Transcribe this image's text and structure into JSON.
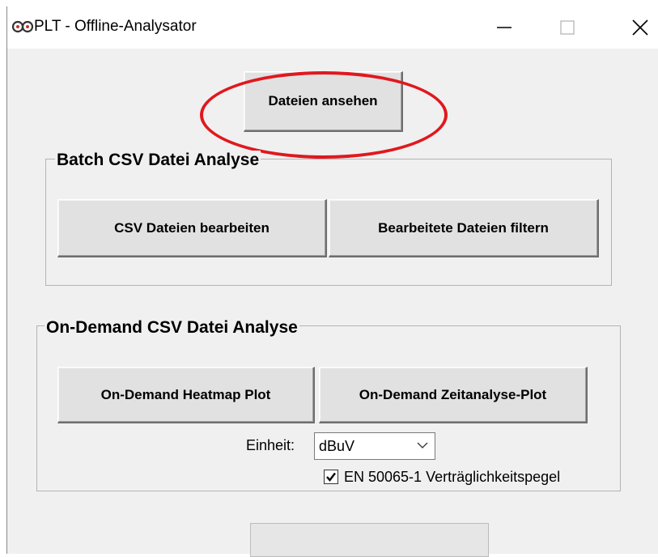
{
  "window": {
    "title": "PLT - Offline-Analysator",
    "app_icon": "infinity-link-icon",
    "controls": [
      "minimize-icon",
      "maximize-icon",
      "close-icon"
    ]
  },
  "top_button": {
    "label": "Dateien ansehen"
  },
  "annotation": {
    "shape": "red-ellipse-highlight",
    "color": "#e0181e"
  },
  "batch_group": {
    "title": "Batch CSV Datei Analyse",
    "buttons": [
      "CSV Dateien bearbeiten",
      "Bearbeitete Dateien filtern"
    ]
  },
  "ondemand_group": {
    "title": "On-Demand CSV Datei Analyse",
    "buttons": [
      "On-Demand Heatmap Plot",
      "On-Demand Zeitanalyse-Plot"
    ],
    "unit_label": "Einheit:",
    "unit_value": "dBuV",
    "checkbox_label": "EN 50065-1 Verträglichkeitspegel",
    "checkbox_checked": true
  },
  "progress": {
    "value": 0
  }
}
